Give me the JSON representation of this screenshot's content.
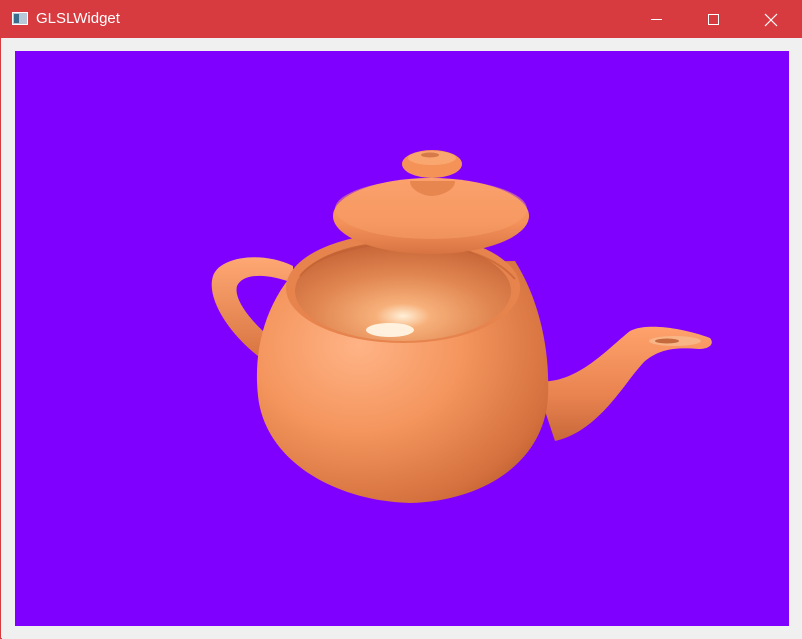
{
  "window": {
    "title": "GLSLWidget",
    "titlebar_color": "#d83b3f",
    "controls": {
      "minimize_icon": "minimize-icon",
      "maximize_icon": "maximize-icon",
      "close_icon": "close-icon"
    }
  },
  "viewport": {
    "clear_color": "#7f00ff",
    "model": "teapot",
    "material_color": "#f4955d"
  }
}
